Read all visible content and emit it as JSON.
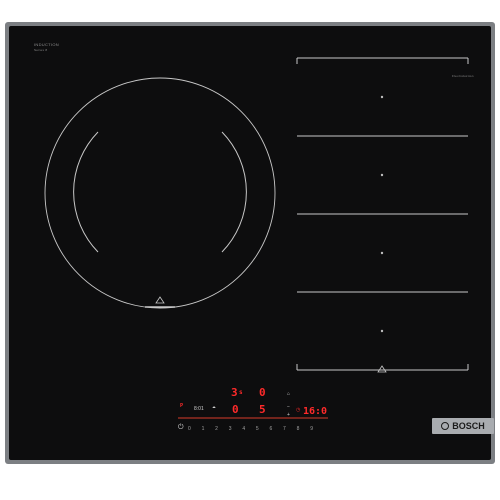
{
  "product": {
    "series_label": "INDUCTION",
    "sub_label": "Series 8",
    "brand": "BOSCH",
    "flex_zone_label": "FlexInduction"
  },
  "displays": {
    "top_left": "3",
    "top_left_sub": "s",
    "top_right": "0",
    "mid_left": "0",
    "mid_right": "5",
    "timer": "16:0",
    "small_left": "8:01",
    "power_indicator": "P"
  },
  "slider_scale": [
    "0",
    "1",
    "2",
    "3",
    "4",
    "5",
    "6",
    "7",
    "8",
    "9"
  ],
  "colors": {
    "glass": "#0d0d0e",
    "frame": "#7c7f83",
    "display_red": "#ff2a2a",
    "zone_lines": "#c8c8c8"
  }
}
